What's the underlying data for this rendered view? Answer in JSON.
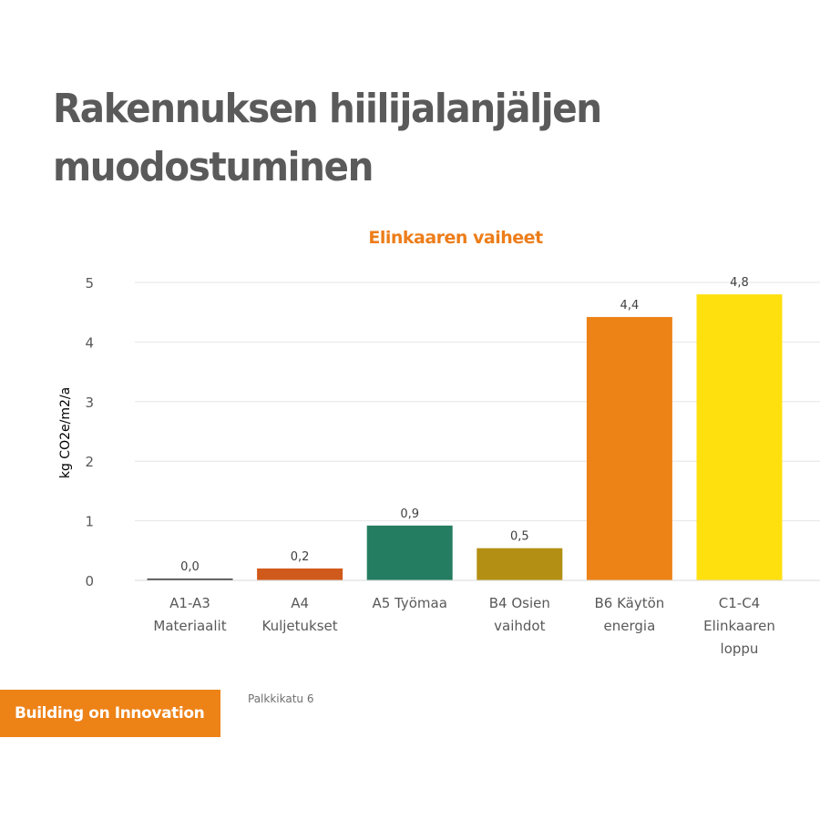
{
  "slide": {
    "title_line1": "Rakennuksen hiilijalanjäljen",
    "title_line2": "muodostuminen"
  },
  "footer": {
    "badge_label": "Building on Innovation",
    "address": "Palkkikatu 6"
  },
  "colors": {
    "accent_orange": "#ed8217",
    "title_gray": "#5a5a5a"
  },
  "chart_data": {
    "type": "bar",
    "title": "Elinkaaren vaiheet",
    "xlabel": "",
    "ylabel": "kg CO2e/m2/a",
    "ylim": [
      0,
      5
    ],
    "yticks": [
      0,
      1,
      2,
      3,
      4,
      5
    ],
    "ytick_labels": [
      "0",
      "1",
      "2",
      "3",
      "4",
      "5"
    ],
    "grid": true,
    "legend": "none",
    "categories": [
      [
        "A1-A3",
        "Materiaalit"
      ],
      [
        "A4",
        "Kuljetukset"
      ],
      [
        "A5 Työmaa"
      ],
      [
        "B4 Osien",
        "vaihdot"
      ],
      [
        "B6 Käytön",
        "energia"
      ],
      [
        "C1-C4",
        "Elinkaaren",
        "loppu"
      ]
    ],
    "values": [
      0.02,
      0.2,
      0.92,
      0.54,
      4.42,
      4.8
    ],
    "data_labels": [
      "0,0",
      "0,2",
      "0,9",
      "0,5",
      "4,4",
      "4,8"
    ],
    "bar_colors": [
      "#404040",
      "#d05a1b",
      "#257d61",
      "#b39013",
      "#ed8217",
      "#ffe00f"
    ]
  }
}
